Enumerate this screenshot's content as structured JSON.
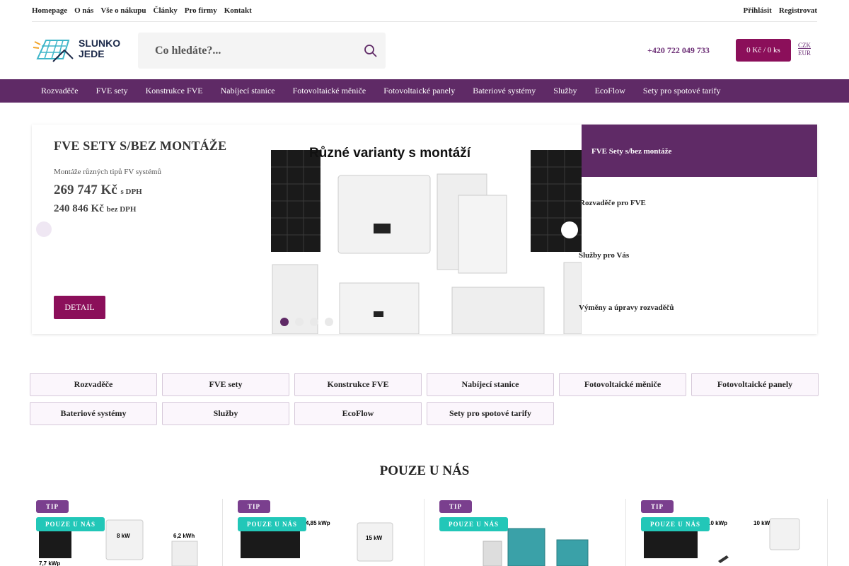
{
  "top_nav": {
    "links": [
      "Homepage",
      "O nás",
      "Vše o nákupu",
      "Články",
      "Pro firmy",
      "Kontakt"
    ],
    "login": "Přihlásit",
    "register": "Registrovat"
  },
  "header": {
    "logo_line1": "SLUNKO",
    "logo_line2": "JEDE",
    "search_placeholder": "Co hledáte?...",
    "phone": "+420 722 049 733",
    "cart": "0 Kč / 0 ks",
    "currency": [
      "CZK",
      "EUR"
    ]
  },
  "categories": [
    "Rozvaděče",
    "FVE sety",
    "Konstrukce FVE",
    "Nabíjecí stanice",
    "Fotovoltaické měniče",
    "Fotovoltaické panely",
    "Bateriové systémy",
    "Služby",
    "EcoFlow",
    "Sety pro spotové tarify"
  ],
  "hero": {
    "title": "FVE SETY S/BEZ MONTÁŽE",
    "subtitle": "Montáže různých tipů FV systémů",
    "price_with_vat": "269 747 Kč",
    "with_vat_label": "s DPH",
    "price_without_vat": "240 846 Kč",
    "without_vat_label": "bez DPH",
    "detail_button": "DETAIL",
    "slide_heading": "Různé varianty s montáží",
    "slide_count": 4,
    "active_slide": 1,
    "side_items": [
      "FVE Sety s/bez montáže",
      "Rozvaděče pro FVE",
      "Služby pro Vás",
      "Výměny a úpravy rozvaděčů"
    ]
  },
  "section_title": "POUZE U NÁS",
  "product_cards": [
    {
      "badge_tip": "TIP",
      "badge_only": "POUZE U NÁS",
      "labels": [
        "8 kW",
        "6,2 kWh",
        "7,7 kWp"
      ]
    },
    {
      "badge_tip": "TIP",
      "badge_only": "POUZE U NÁS",
      "labels": [
        "4,85 kWp",
        "15 kW"
      ]
    },
    {
      "badge_tip": "TIP",
      "badge_only": "POUZE U NÁS",
      "labels": []
    },
    {
      "badge_tip": "TIP",
      "badge_only": "POUZE U NÁS",
      "labels": [
        "10 kWp",
        "10 kW"
      ]
    }
  ],
  "colors": {
    "brand_purple": "#5f2a66",
    "accent_magenta": "#8b0f5a",
    "badge_tip": "#7a3f8e",
    "badge_only": "#22c7b8"
  }
}
